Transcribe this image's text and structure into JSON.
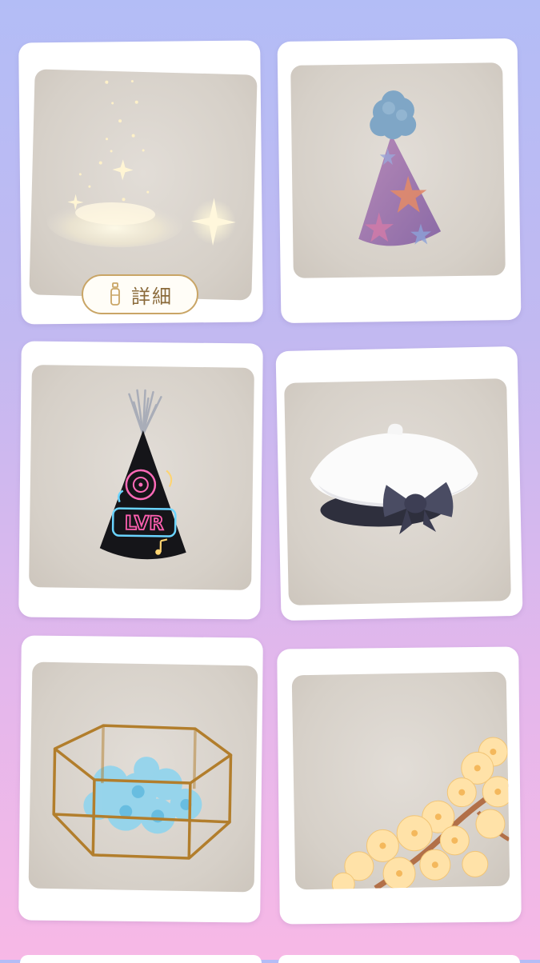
{
  "grid": {
    "items": [
      {
        "name": "sparkle-dust",
        "detail_label": "詳細"
      },
      {
        "name": "star-party-hat"
      },
      {
        "name": "neon-lvr-party-hat",
        "hat_text": "LVR"
      },
      {
        "name": "white-beret-bow"
      },
      {
        "name": "glass-terrarium-blue-flowers"
      },
      {
        "name": "yellow-blossom-branch"
      }
    ]
  },
  "colors": {
    "accent": "#c9a566",
    "card": "#ffffff",
    "photo_bg": "#d9d3cc"
  }
}
